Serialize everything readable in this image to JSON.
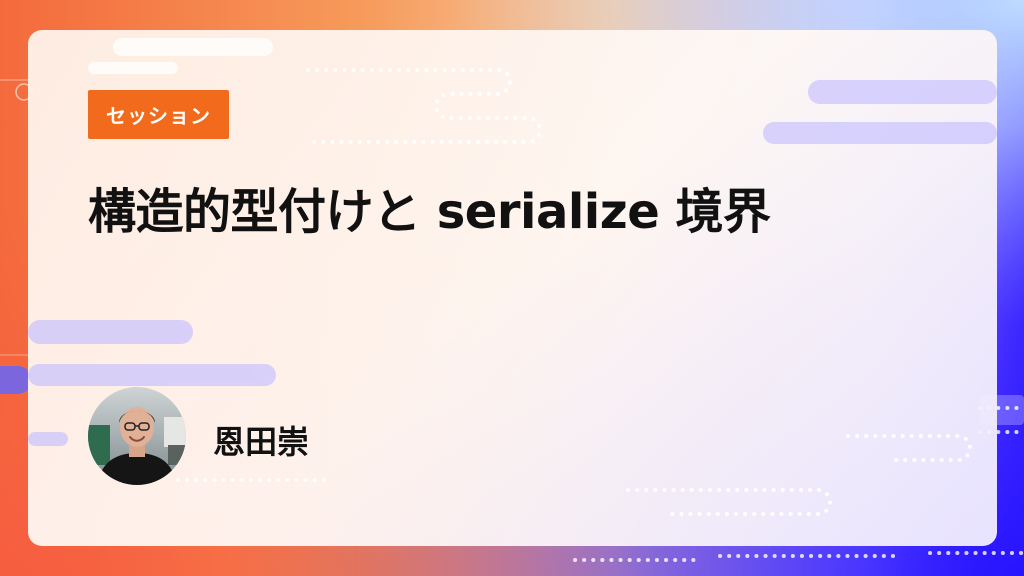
{
  "session": {
    "badge_label": "セッション",
    "title": "構造的型付けと serialize 境界",
    "speaker_name": "恩田崇"
  },
  "colors": {
    "badge": "#f26a1b",
    "text": "#111111",
    "accent_purple": "#c8c2ff",
    "accent_orange": "#f46a3c",
    "accent_blue": "#2814ff"
  },
  "icons": {
    "avatar": "speaker-photo"
  }
}
